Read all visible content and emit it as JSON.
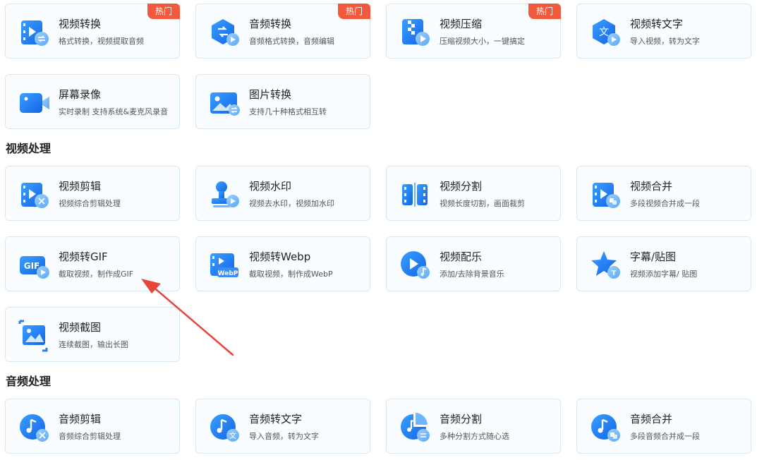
{
  "hot_label": "热门",
  "sections": {
    "video": "视频处理",
    "audio": "音频处理"
  },
  "cards": {
    "video_convert": {
      "title": "视频转换",
      "sub": "格式转换，视频提取音频"
    },
    "audio_convert": {
      "title": "音频转换",
      "sub": "音频格式转换，音频编辑"
    },
    "video_compress": {
      "title": "视频压缩",
      "sub": "压缩视频大小，一键搞定"
    },
    "video_to_text": {
      "title": "视频转文字",
      "sub": "导入视频，转为文字"
    },
    "screen_record": {
      "title": "屏幕录像",
      "sub": "实时录制 支持系统&麦克风录音"
    },
    "image_convert": {
      "title": "图片转换",
      "sub": "支持几十种格式相互转"
    },
    "video_edit": {
      "title": "视频剪辑",
      "sub": "视频综合剪辑处理"
    },
    "video_watermark": {
      "title": "视频水印",
      "sub": "视频去水印，视频加水印"
    },
    "video_split": {
      "title": "视频分割",
      "sub": "视频长度切割，画面裁剪"
    },
    "video_merge": {
      "title": "视频合并",
      "sub": "多段视频合并成一段"
    },
    "video_to_gif": {
      "title": "视频转GIF",
      "sub": "截取视频，制作成GIF"
    },
    "video_to_webp": {
      "title": "视频转Webp",
      "sub": "截取视频，制作成WebP"
    },
    "video_music": {
      "title": "视频配乐",
      "sub": "添加/去除背景音乐"
    },
    "subtitle_sticker": {
      "title": "字幕/贴图",
      "sub": "视频添加字幕/ 贴图"
    },
    "video_screenshot": {
      "title": "视频截图",
      "sub": "连续截图，输出长图"
    },
    "audio_edit": {
      "title": "音频剪辑",
      "sub": "音频综合剪辑处理"
    },
    "audio_to_text": {
      "title": "音频转文字",
      "sub": "导入音频，转为文字"
    },
    "audio_split": {
      "title": "音频分割",
      "sub": "多种分割方式随心选"
    },
    "audio_merge": {
      "title": "音频合并",
      "sub": "多段音频合并成一段"
    }
  },
  "icons": {
    "video_convert": "video-convert-icon",
    "audio_convert": "audio-convert-icon",
    "video_compress": "video-compress-icon",
    "video_to_text": "video-to-text-icon",
    "screen_record": "screen-record-icon",
    "image_convert": "image-convert-icon",
    "video_edit": "video-edit-icon",
    "video_watermark": "watermark-stamp-icon",
    "video_split": "film-split-icon",
    "video_merge": "video-merge-icon",
    "video_to_gif": "gif-icon",
    "video_to_webp": "webp-icon",
    "video_music": "video-music-icon",
    "subtitle_sticker": "star-subtitle-icon",
    "video_screenshot": "crop-screenshot-icon",
    "audio_edit": "audio-edit-icon",
    "audio_to_text": "audio-to-text-icon",
    "audio_split": "audio-split-icon",
    "audio_merge": "audio-merge-icon"
  },
  "colors": {
    "accent_blue": "#1a7ff0",
    "hot_badge": "#f25a3d",
    "arrow": "#e8443a"
  }
}
